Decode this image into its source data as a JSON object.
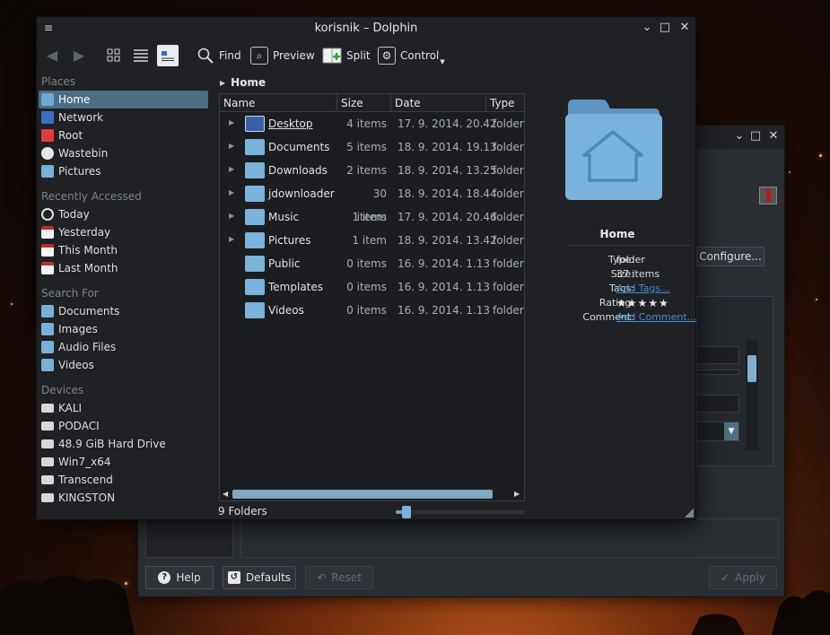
{
  "dolphin": {
    "title": "korisnik – Dolphin",
    "window_controls": {
      "menu": "≡",
      "minimize": "⌄",
      "maximize": "□",
      "close": "✕"
    },
    "toolbar": {
      "back_icon": "arrow-left-icon",
      "forward_icon": "arrow-right-icon",
      "find": "Find",
      "preview": "Preview",
      "split": "Split",
      "control": "Control"
    },
    "sidebar": {
      "places_title": "Places",
      "places": [
        {
          "label": "Home",
          "icon": "home-icon",
          "selected": true
        },
        {
          "label": "Network",
          "icon": "network-icon"
        },
        {
          "label": "Root",
          "icon": "root-folder-icon"
        },
        {
          "label": "Wastebin",
          "icon": "trash-icon"
        },
        {
          "label": "Pictures",
          "icon": "folder-icon"
        }
      ],
      "recent_title": "Recently Accessed",
      "recent": [
        {
          "label": "Today",
          "icon": "clock-icon"
        },
        {
          "label": "Yesterday",
          "icon": "calendar-icon"
        },
        {
          "label": "This Month",
          "icon": "calendar-icon"
        },
        {
          "label": "Last Month",
          "icon": "calendar-icon"
        }
      ],
      "search_title": "Search For",
      "search": [
        {
          "label": "Documents",
          "icon": "documents-icon"
        },
        {
          "label": "Images",
          "icon": "images-icon"
        },
        {
          "label": "Audio Files",
          "icon": "audio-icon"
        },
        {
          "label": "Videos",
          "icon": "video-icon"
        }
      ],
      "devices_title": "Devices",
      "devices": [
        {
          "label": "KALI",
          "icon": "drive-icon"
        },
        {
          "label": "PODACI",
          "icon": "drive-icon"
        },
        {
          "label": "48.9 GiB Hard Drive",
          "icon": "drive-icon"
        },
        {
          "label": "Win7_x64",
          "icon": "drive-icon"
        },
        {
          "label": "Transcend",
          "icon": "drive-icon"
        },
        {
          "label": "KINGSTON",
          "icon": "drive-icon"
        }
      ]
    },
    "breadcrumb": "Home",
    "columns": {
      "name": "Name",
      "size": "Size",
      "date": "Date",
      "type": "Type"
    },
    "files": [
      {
        "name": "Desktop",
        "size": "4 items",
        "date": "17. 9. 2014. 20.42",
        "type": "folder",
        "expandable": true
      },
      {
        "name": "Documents",
        "size": "5 items",
        "date": "18. 9. 2014. 19.13",
        "type": "folder",
        "expandable": true
      },
      {
        "name": "Downloads",
        "size": "2 items",
        "date": "18. 9. 2014. 13.25",
        "type": "folder",
        "expandable": true
      },
      {
        "name": "jdownloader",
        "size": "30 items",
        "date": "18. 9. 2014. 18.44",
        "type": "folder",
        "expandable": true
      },
      {
        "name": "Music",
        "size": "1 item",
        "date": "17. 9. 2014. 20.46",
        "type": "folder",
        "expandable": true
      },
      {
        "name": "Pictures",
        "size": "1 item",
        "date": "18. 9. 2014. 13.42",
        "type": "folder",
        "expandable": true
      },
      {
        "name": "Public",
        "size": "0 items",
        "date": "16. 9. 2014. 1.13",
        "type": "folder",
        "expandable": false
      },
      {
        "name": "Templates",
        "size": "0 items",
        "date": "16. 9. 2014. 1.13",
        "type": "folder",
        "expandable": false
      },
      {
        "name": "Videos",
        "size": "0 items",
        "date": "16. 9. 2014. 1.13",
        "type": "folder",
        "expandable": false
      }
    ],
    "status": "9 Folders",
    "zoom_level": 0.08,
    "info": {
      "title": "Home",
      "type_label": "Type:",
      "type_value": "folder",
      "size_label": "Size:",
      "size_value": "37 items",
      "tags_label": "Tags:",
      "tags_value": "Add Tags...",
      "rating_label": "Rating:",
      "rating_stars": 5,
      "comment_label": "Comment:",
      "comment_value": "Add Comment..."
    }
  },
  "back_window": {
    "window_controls": {
      "minimize": "⌄",
      "maximize": "□",
      "close": "✕"
    },
    "configure_button": "Configure...",
    "help_button": "Help",
    "defaults_button": "Defaults",
    "reset_button": "Reset",
    "apply_button": "Apply"
  },
  "colors": {
    "accent": "#4d6d84",
    "link": "#3d8fd0",
    "folder": "#7ab3dc",
    "window_bg": "#1f2125"
  }
}
